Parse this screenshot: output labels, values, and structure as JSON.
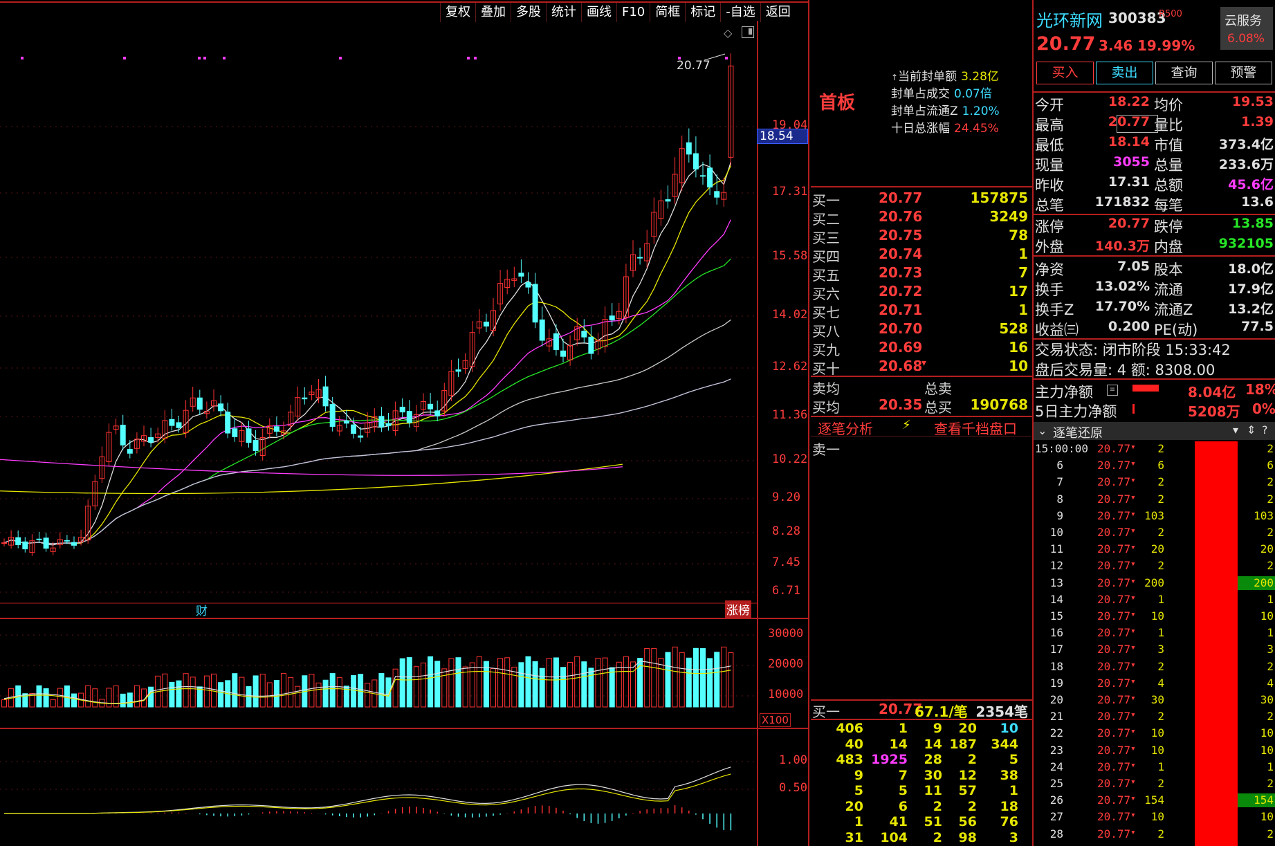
{
  "toolbar": [
    "复权",
    "叠加",
    "多股",
    "统计",
    "画线",
    "F10",
    "简框",
    "标记",
    "-自选",
    "返回"
  ],
  "price_axis": [
    "19.04",
    "17.31",
    "15.58",
    "14.02",
    "12.62",
    "11.36",
    "10.22",
    "9.20",
    "8.28",
    "7.45",
    "6.71"
  ],
  "current_price_tag": "18.54",
  "high_label": "20.77",
  "markers": {
    "cai": "财",
    "zhangbang": "涨榜"
  },
  "volume_axis": [
    "30000",
    "20000",
    "10000"
  ],
  "volume_unit": "X100",
  "macd_axis": [
    "1.00",
    "0.50"
  ],
  "mid": {
    "board_label": "首板",
    "seal_info": [
      {
        "label": "当前封单额",
        "value": "3.28亿",
        "color": "#e6e600"
      },
      {
        "label": "封单占成交",
        "value": "0.07倍",
        "color": "#3cdcff"
      },
      {
        "label": "封单占流通Z",
        "value": "1.20%",
        "color": "#3cdcff"
      },
      {
        "label": "十日总涨幅",
        "value": "24.45%",
        "color": "#ff3c3c"
      }
    ],
    "buy_book": [
      {
        "label": "买一",
        "price": "20.77",
        "vol": "157875"
      },
      {
        "label": "买二",
        "price": "20.76",
        "vol": "3249"
      },
      {
        "label": "买三",
        "price": "20.75",
        "vol": "78"
      },
      {
        "label": "买四",
        "price": "20.74",
        "vol": "1"
      },
      {
        "label": "买五",
        "price": "20.73",
        "vol": "7"
      },
      {
        "label": "买六",
        "price": "20.72",
        "vol": "17"
      },
      {
        "label": "买七",
        "price": "20.71",
        "vol": "1"
      },
      {
        "label": "买八",
        "price": "20.70",
        "vol": "528"
      },
      {
        "label": "买九",
        "price": "20.69",
        "vol": "16"
      },
      {
        "label": "买十",
        "price": "20.68",
        "vol": "10"
      }
    ],
    "avg": {
      "sell_avg_label": "卖均",
      "sell_total_label": "总卖",
      "buy_avg_label": "买均",
      "buy_avg": "20.35",
      "buy_total_label": "总买",
      "buy_total": "190768"
    },
    "tabs": {
      "tick_analysis": "逐笔分析",
      "view_thousand": "查看千档盘口"
    },
    "sell_one": "卖一",
    "bottom": {
      "label": "买一",
      "price": "20.77",
      "per": "67.1/笔",
      "count": "2354笔"
    },
    "queue": [
      [
        "406",
        "1",
        "9",
        "20",
        "10"
      ],
      [
        "40",
        "14",
        "14",
        "187",
        "344"
      ],
      [
        "483",
        "1925",
        "28",
        "2",
        "5"
      ],
      [
        "9",
        "7",
        "30",
        "12",
        "38"
      ],
      [
        "5",
        "5",
        "11",
        "57",
        "1"
      ],
      [
        "20",
        "6",
        "2",
        "2",
        "18"
      ],
      [
        "1",
        "41",
        "51",
        "56",
        "76"
      ],
      [
        "31",
        "104",
        "2",
        "98",
        "3"
      ]
    ]
  },
  "right": {
    "name": "光环新网",
    "code": "300383",
    "badge": "R500",
    "cloud": "云服务",
    "cloud_pct": "6.08%",
    "price": "20.77",
    "change": "3.46",
    "pct": "19.99%",
    "buttons": [
      "买入",
      "卖出",
      "查询",
      "预警"
    ],
    "quote": [
      {
        "l1": "今开",
        "v1": "18.22",
        "c1": "#ff3c3c",
        "l2": "均价",
        "v2": "19.53",
        "c2": "#ff3c3c"
      },
      {
        "l1": "最高",
        "v1": "20.77",
        "c1": "#ff3c3c",
        "l2": "量比",
        "v2": "1.39",
        "c2": "#ff3c3c"
      },
      {
        "l1": "最低",
        "v1": "18.14",
        "c1": "#ff3c3c",
        "l2": "市值",
        "v2": "373.4亿",
        "c2": "#e0e0e0"
      },
      {
        "l1": "现量",
        "v1": "3055",
        "c1": "#ff3cff",
        "l2": "总量",
        "v2": "233.6万",
        "c2": "#e0e0e0"
      },
      {
        "l1": "昨收",
        "v1": "17.31",
        "c1": "#e0e0e0",
        "l2": "总额",
        "v2": "45.6亿",
        "c2": "#ff3cff"
      },
      {
        "l1": "总笔",
        "v1": "171832",
        "c1": "#e0e0e0",
        "l2": "每笔",
        "v2": "13.6",
        "c2": "#e0e0e0"
      },
      {
        "l1": "涨停",
        "v1": "20.77",
        "c1": "#ff3c3c",
        "l2": "跌停",
        "v2": "13.85",
        "c2": "#26e626"
      },
      {
        "l1": "外盘",
        "v1": "140.3万",
        "c1": "#ff3c3c",
        "l2": "内盘",
        "v2": "932105",
        "c2": "#26e626"
      },
      {
        "l1": "净资",
        "v1": "7.05",
        "c1": "#e0e0e0",
        "l2": "股本",
        "v2": "18.0亿",
        "c2": "#e0e0e0"
      },
      {
        "l1": "换手",
        "v1": "13.02%",
        "c1": "#e0e0e0",
        "l2": "流通",
        "v2": "17.9亿",
        "c2": "#e0e0e0"
      },
      {
        "l1": "换手Z",
        "v1": "17.70%",
        "c1": "#e0e0e0",
        "l2": "流通Z",
        "v2": "13.2亿",
        "c2": "#e0e0e0"
      },
      {
        "l1": "收益㈢",
        "v1": "0.200",
        "c1": "#e0e0e0",
        "l2": "PE(动)",
        "v2": "77.5",
        "c2": "#e0e0e0"
      }
    ],
    "trade_status": "交易状态: 闭市阶段 15:33:42",
    "after_hours": "盘后交易量: 4  额: 8308.00",
    "main_net_label": "主力净额",
    "main_net": "8.04亿",
    "main_net_pct": "18%",
    "main5_label": "5日主力净额",
    "main5": "5208万",
    "main5_pct": "0%",
    "tick_title": "逐笔还原",
    "ticks": [
      {
        "t": "15:00:00",
        "p": "20.77",
        "v": "2",
        "r": "2"
      },
      {
        "t": "6",
        "p": "20.77",
        "v": "6",
        "r": "6"
      },
      {
        "t": "7",
        "p": "20.77",
        "v": "2",
        "r": "2"
      },
      {
        "t": "8",
        "p": "20.77",
        "v": "2",
        "r": "2"
      },
      {
        "t": "9",
        "p": "20.77",
        "v": "103",
        "r": "103"
      },
      {
        "t": "10",
        "p": "20.77",
        "v": "2",
        "r": "2"
      },
      {
        "t": "11",
        "p": "20.77",
        "v": "20",
        "r": "20"
      },
      {
        "t": "12",
        "p": "20.77",
        "v": "2",
        "r": "2"
      },
      {
        "t": "13",
        "p": "20.77",
        "v": "200",
        "r": "200"
      },
      {
        "t": "14",
        "p": "20.77",
        "v": "1",
        "r": "1"
      },
      {
        "t": "15",
        "p": "20.77",
        "v": "10",
        "r": "10"
      },
      {
        "t": "16",
        "p": "20.77",
        "v": "1",
        "r": "1"
      },
      {
        "t": "17",
        "p": "20.77",
        "v": "3",
        "r": "3"
      },
      {
        "t": "18",
        "p": "20.77",
        "v": "2",
        "r": "2"
      },
      {
        "t": "19",
        "p": "20.77",
        "v": "4",
        "r": "4"
      },
      {
        "t": "20",
        "p": "20.77",
        "v": "30",
        "r": "30"
      },
      {
        "t": "21",
        "p": "20.77",
        "v": "2",
        "r": "2"
      },
      {
        "t": "22",
        "p": "20.77",
        "v": "10",
        "r": "10"
      },
      {
        "t": "23",
        "p": "20.77",
        "v": "10",
        "r": "10"
      },
      {
        "t": "24",
        "p": "20.77",
        "v": "1",
        "r": "1"
      },
      {
        "t": "25",
        "p": "20.77",
        "v": "2",
        "r": "2"
      },
      {
        "t": "26",
        "p": "20.77",
        "v": "154",
        "r": "154"
      },
      {
        "t": "27",
        "p": "20.77",
        "v": "10",
        "r": "10"
      },
      {
        "t": "28",
        "p": "20.77",
        "v": "2",
        "r": "2"
      }
    ]
  }
}
